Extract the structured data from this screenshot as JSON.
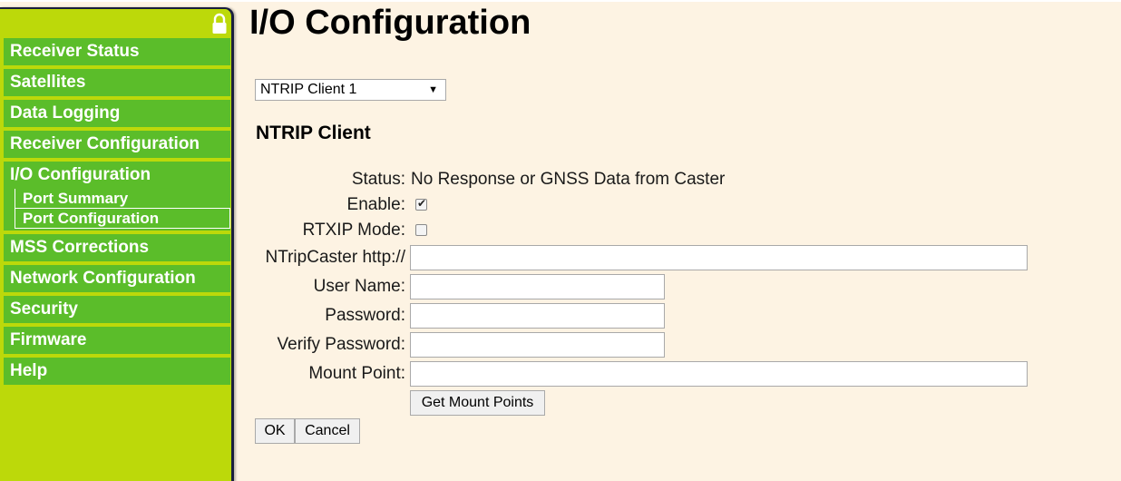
{
  "page": {
    "title": "I/O Configuration"
  },
  "sidebar": {
    "items": [
      {
        "label": "Receiver Status"
      },
      {
        "label": "Satellites"
      },
      {
        "label": "Data Logging"
      },
      {
        "label": "Receiver Configuration"
      },
      {
        "label": "I/O Configuration",
        "subitems": [
          {
            "label": "Port Summary"
          },
          {
            "label": "Port Configuration",
            "selected": true
          }
        ]
      },
      {
        "label": "MSS Corrections"
      },
      {
        "label": "Network Configuration"
      },
      {
        "label": "Security"
      },
      {
        "label": "Firmware"
      },
      {
        "label": "Help"
      }
    ],
    "lock_icon": "padlock-icon"
  },
  "client_selector": {
    "selected": "NTRIP Client 1"
  },
  "section": {
    "title": "NTRIP Client"
  },
  "form": {
    "status_label": "Status:",
    "status_value": "No Response or GNSS Data from Caster",
    "enable_label": "Enable:",
    "enable_checked": true,
    "rtxip_label": "RTXIP Mode:",
    "rtxip_checked": false,
    "caster_label": "NTripCaster http://",
    "caster_value": "",
    "username_label": "User Name:",
    "username_value": "",
    "password_label": "Password:",
    "password_value": "",
    "verify_label": "Verify Password:",
    "verify_value": "",
    "mount_label": "Mount Point:",
    "mount_value": ""
  },
  "buttons": {
    "get_mount_points": "Get Mount Points",
    "ok": "OK",
    "cancel": "Cancel"
  },
  "colors": {
    "sidebar_bg": "#bcd90a",
    "nav_item_bg": "#5bbd2a",
    "page_bg": "#fdf3e3",
    "sidebar_border": "#1a1f3d"
  }
}
